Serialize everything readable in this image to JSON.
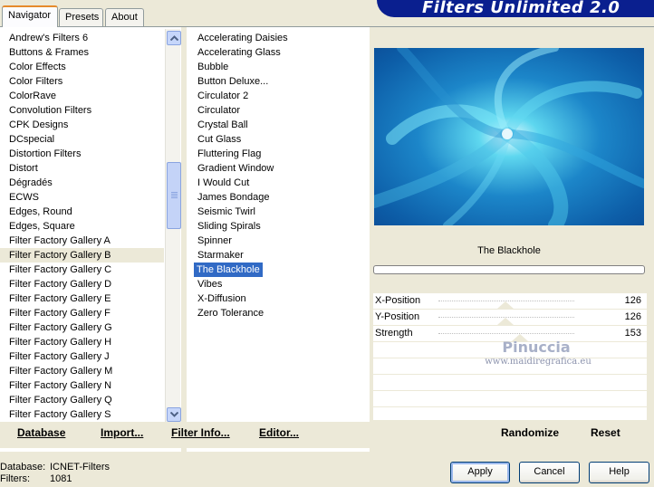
{
  "tabs": [
    {
      "label": "Navigator",
      "active": true
    },
    {
      "label": "Presets",
      "active": false
    },
    {
      "label": "About",
      "active": false
    }
  ],
  "header": {
    "title": "Filters Unlimited 2.0"
  },
  "categories": [
    "Andrew's Filters 6",
    "Buttons & Frames",
    "Color Effects",
    "Color Filters",
    "ColorRave",
    "Convolution Filters",
    "CPK Designs",
    "DCspecial",
    "Distortion Filters",
    "Distort",
    "Dégradés",
    "ECWS",
    "Edges, Round",
    "Edges, Square",
    "Filter Factory Gallery A",
    "Filter Factory Gallery B",
    "Filter Factory Gallery C",
    "Filter Factory Gallery D",
    "Filter Factory Gallery E",
    "Filter Factory Gallery F",
    "Filter Factory Gallery G",
    "Filter Factory Gallery H",
    "Filter Factory Gallery J",
    "Filter Factory Gallery M",
    "Filter Factory Gallery N",
    "Filter Factory Gallery Q",
    "Filter Factory Gallery S"
  ],
  "selected_category": "Filter Factory Gallery B",
  "filters": [
    "Accelerating Daisies",
    "Accelerating Glass",
    "Bubble",
    "Button Deluxe...",
    "Circulator 2",
    "Circulator",
    "Crystal Ball",
    "Cut Glass",
    "Fluttering Flag",
    "Gradient Window",
    "I Would Cut",
    "James Bondage",
    "Seismic Twirl",
    "Sliding Spirals",
    "Spinner",
    "Starmaker",
    "The Blackhole",
    "Vibes",
    "X-Diffusion",
    "Zero Tolerance"
  ],
  "selected_filter": "The Blackhole",
  "preview": {
    "filter_name": "The Blackhole"
  },
  "parameters": [
    {
      "label": "X-Position",
      "value": "126",
      "fraction": 0.494
    },
    {
      "label": "Y-Position",
      "value": "126",
      "fraction": 0.494
    },
    {
      "label": "Strength",
      "value": "153",
      "fraction": 0.6
    }
  ],
  "watermark": {
    "name": "Pinuccia",
    "url": "www.maidiregrafica.eu"
  },
  "toolbar": {
    "database": "Database",
    "import": "Import...",
    "filter_info": "Filter Info...",
    "editor": "Editor...",
    "randomize": "Randomize",
    "reset": "Reset"
  },
  "info": {
    "database_label": "Database:",
    "database_value": "ICNET-Filters",
    "filters_label": "Filters:",
    "filters_value": "1081"
  },
  "buttons": {
    "apply": "Apply",
    "cancel": "Cancel",
    "help": "Help"
  },
  "colors": {
    "selection": "#316ac5",
    "banner": "#0a1f8f",
    "tab_highlight": "#e68b2c"
  }
}
